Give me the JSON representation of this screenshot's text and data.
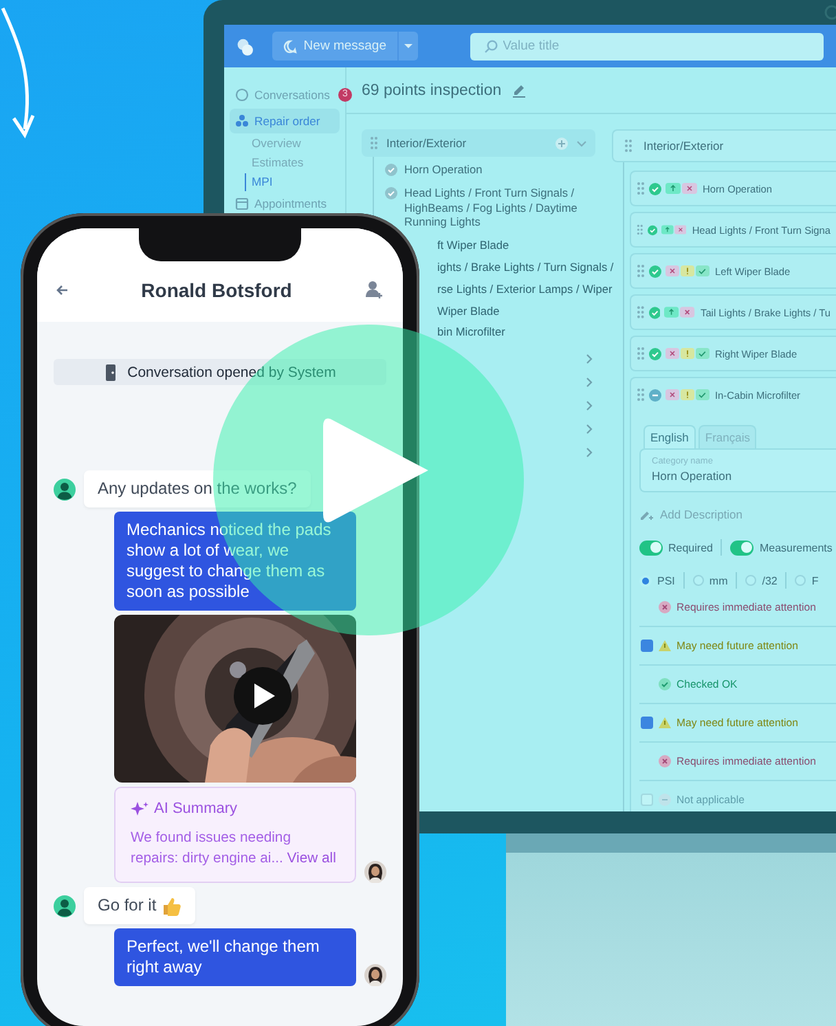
{
  "monitor": {
    "toolbar": {
      "new_message": "New message",
      "search": {
        "placeholder": "Value title"
      }
    },
    "sidebar": {
      "items": [
        {
          "label": "Conversations",
          "badge": "3",
          "selected": false
        },
        {
          "label": "Repair order",
          "selected": true,
          "children": [
            {
              "label": "Overview",
              "selected": false
            },
            {
              "label": "Estimates",
              "selected": false
            },
            {
              "label": "MPI",
              "selected": true
            }
          ]
        },
        {
          "label": "Appointments",
          "selected": false
        }
      ]
    },
    "title": "69 points inspection",
    "checklist": {
      "header": "Interior/Exterior",
      "items": [
        {
          "label": "Horn Operation",
          "kind": "full",
          "checked": true
        },
        {
          "label": "Head Lights / Front Turn Signals / HighBeams / Fog Lights / Daytime Running Lights",
          "kind": "full",
          "checked": true
        },
        {
          "label": "ft Wiper Blade",
          "kind": "partial"
        },
        {
          "label": "ights / Brake Lights / Turn Signals /",
          "kind": "partial"
        },
        {
          "label": "rse Lights / Exterior Lamps / Wiper",
          "kind": "partial"
        },
        {
          "label": "Wiper Blade",
          "kind": "partial"
        },
        {
          "label": "bin Microfilter",
          "kind": "partial"
        }
      ],
      "sections": [
        {
          "kind": "section"
        },
        {
          "kind": "section"
        },
        {
          "kind": "section"
        },
        {
          "kind": "section"
        },
        {
          "kind": "section"
        }
      ]
    },
    "inspection": {
      "header": "Interior/Exterior",
      "rows": [
        {
          "label": "Horn Operation",
          "kind": "pair",
          "done": true,
          "expanded": false
        },
        {
          "label": "Head Lights / Front Turn Signa",
          "kind": "pair",
          "done": true,
          "expanded": false
        },
        {
          "label": "Left Wiper Blade",
          "kind": "triple",
          "done": true,
          "expanded": false
        },
        {
          "label": "Tail Lights / Brake Lights / Tu",
          "kind": "pair",
          "done": true,
          "expanded": false
        },
        {
          "label": "Right Wiper Blade",
          "kind": "triple",
          "done": true,
          "expanded": false
        },
        {
          "label": "In-Cabin Microfilter",
          "kind": "triple",
          "done": false,
          "expanded": true
        }
      ]
    },
    "editor": {
      "tabs": [
        {
          "label": "English",
          "selected": true
        },
        {
          "label": "Français",
          "selected": false
        }
      ],
      "field": {
        "label": "Category name",
        "value": "Horn Operation"
      },
      "add_description": "Add Description",
      "toggles": [
        {
          "label": "Required",
          "on": true
        },
        {
          "label": "Measurements",
          "on": true
        }
      ],
      "units": [
        {
          "label": "PSI",
          "selected": true
        },
        {
          "label": "mm",
          "selected": false
        },
        {
          "label": "/32",
          "selected": false
        },
        {
          "label": "F",
          "selected": false
        }
      ],
      "ratings": [
        {
          "label": "Requires immediate attention",
          "kind": "critical"
        },
        {
          "label": "May need future attention",
          "kind": "warning",
          "checked": true
        },
        {
          "label": "Checked OK",
          "kind": "ok"
        },
        {
          "label": "May need future attention",
          "kind": "warning",
          "checked": true
        },
        {
          "label": "Requires immediate attention",
          "kind": "critical"
        },
        {
          "label": "Not applicable",
          "kind": "na",
          "checked": false
        }
      ]
    }
  },
  "phone": {
    "title": "Ronald Botsford",
    "system_note": "Conversation opened by System",
    "messages": [
      {
        "kind": "incoming",
        "text": "Any updates on the works?",
        "avatar": true
      },
      {
        "kind": "outgoing",
        "text": "Mechanics noticed the pads show a lot of wear, we suggest to change them as soon as possible",
        "avatar": false
      },
      {
        "kind": "video",
        "avatar": false
      },
      {
        "kind": "summary",
        "title": "AI Summary",
        "text": "We found issues needing repairs: dirty engine ai...",
        "link": "View all",
        "avatar": true
      },
      {
        "kind": "incoming",
        "text": "Go for it",
        "thumbs_up": true,
        "avatar": true
      },
      {
        "kind": "outgoing",
        "text": "Perfect, we'll change them right away",
        "avatar": true
      }
    ]
  }
}
